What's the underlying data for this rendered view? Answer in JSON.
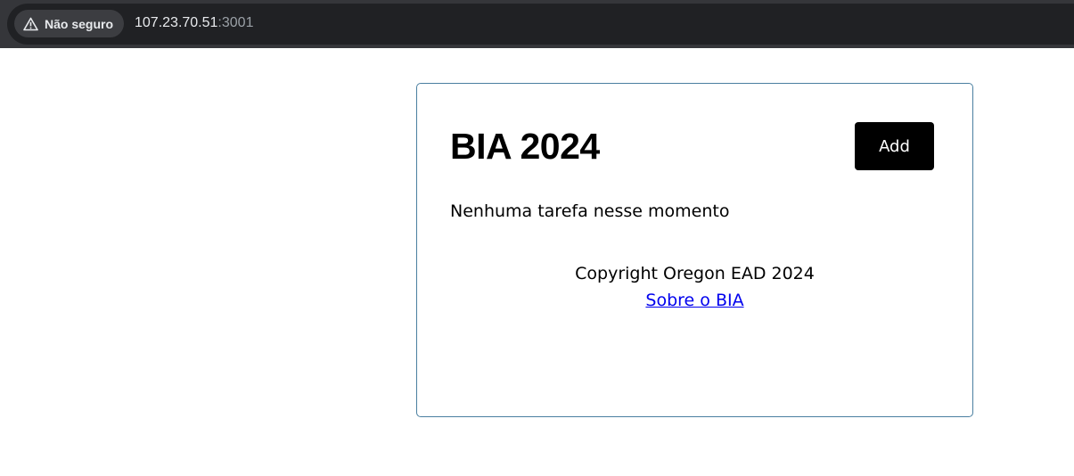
{
  "browser": {
    "security_label": "Não seguro",
    "security_icon": "warning-triangle-icon",
    "url_host": "107.23.70.51",
    "url_port": ":3001"
  },
  "app": {
    "title": "BIA 2024",
    "add_label": "Add",
    "empty_message": "Nenhuma tarefa nesse momento",
    "copyright": "Copyright Oregon EAD 2024",
    "about_link": "Sobre o BIA"
  }
}
